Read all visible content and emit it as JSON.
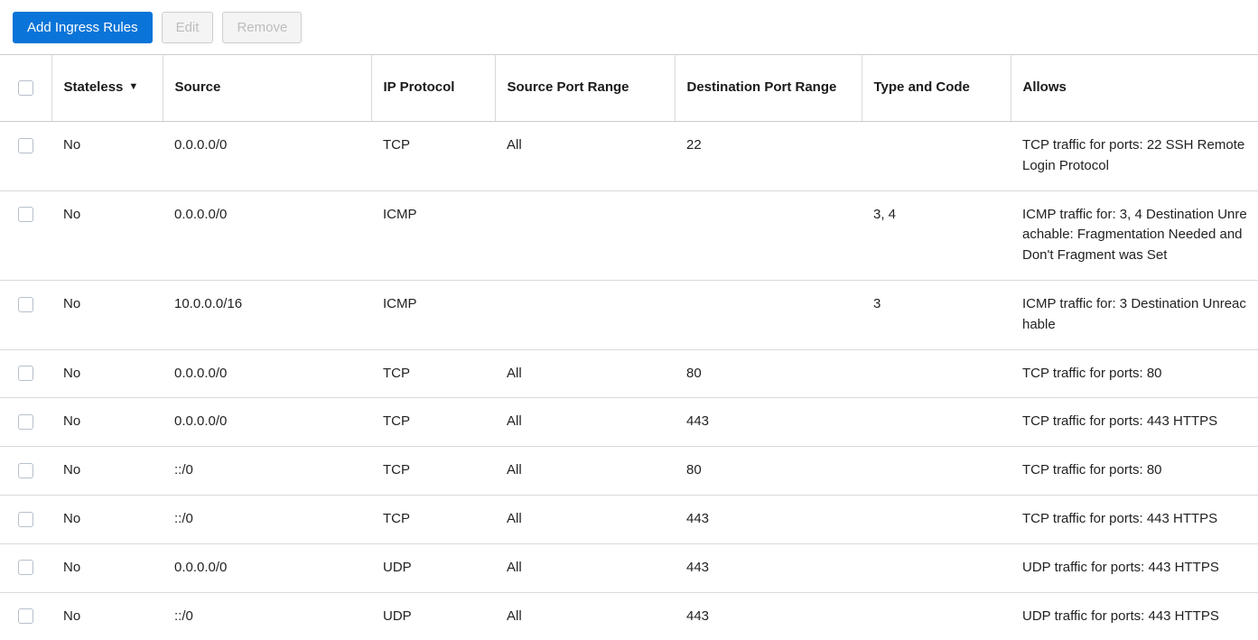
{
  "toolbar": {
    "add_label": "Add Ingress Rules",
    "edit_label": "Edit",
    "remove_label": "Remove",
    "primary_color": "#0a74d8",
    "disabled_text_color": "#bdbdbd"
  },
  "table": {
    "select_all_checked": false,
    "sort_column": "Stateless",
    "sort_caret": "▼",
    "columns": [
      {
        "key": "checkbox",
        "label": ""
      },
      {
        "key": "stateless",
        "label": "Stateless",
        "sortable": true
      },
      {
        "key": "source",
        "label": "Source"
      },
      {
        "key": "protocol",
        "label": "IP Protocol"
      },
      {
        "key": "source_port_range",
        "label": "Source Port Range"
      },
      {
        "key": "destination_port_range",
        "label": "Destination Port Range"
      },
      {
        "key": "type_and_code",
        "label": "Type and Code"
      },
      {
        "key": "allows",
        "label": "Allows"
      }
    ],
    "rows": [
      {
        "selected": false,
        "stateless": "No",
        "source": "0.0.0.0/0",
        "protocol": "TCP",
        "source_port_range": "All",
        "destination_port_range": "22",
        "type_and_code": "",
        "allows": "TCP traffic for ports: 22 SSH Remote Login Protocol"
      },
      {
        "selected": false,
        "stateless": "No",
        "source": "0.0.0.0/0",
        "protocol": "ICMP",
        "source_port_range": "",
        "destination_port_range": "",
        "type_and_code": "3, 4",
        "allows": "ICMP traffic for: 3, 4 Destination Unreachable: Fragmentation Needed and Don't Fragment was Set"
      },
      {
        "selected": false,
        "stateless": "No",
        "source": "10.0.0.0/16",
        "protocol": "ICMP",
        "source_port_range": "",
        "destination_port_range": "",
        "type_and_code": "3",
        "allows": "ICMP traffic for: 3 Destination Unreachable"
      },
      {
        "selected": false,
        "stateless": "No",
        "source": "0.0.0.0/0",
        "protocol": "TCP",
        "source_port_range": "All",
        "destination_port_range": "80",
        "type_and_code": "",
        "allows": "TCP traffic for ports: 80"
      },
      {
        "selected": false,
        "stateless": "No",
        "source": "0.0.0.0/0",
        "protocol": "TCP",
        "source_port_range": "All",
        "destination_port_range": "443",
        "type_and_code": "",
        "allows": "TCP traffic for ports: 443 HTTPS"
      },
      {
        "selected": false,
        "stateless": "No",
        "source": "::/0",
        "protocol": "TCP",
        "source_port_range": "All",
        "destination_port_range": "80",
        "type_and_code": "",
        "allows": "TCP traffic for ports: 80"
      },
      {
        "selected": false,
        "stateless": "No",
        "source": "::/0",
        "protocol": "TCP",
        "source_port_range": "All",
        "destination_port_range": "443",
        "type_and_code": "",
        "allows": "TCP traffic for ports: 443 HTTPS"
      },
      {
        "selected": false,
        "stateless": "No",
        "source": "0.0.0.0/0",
        "protocol": "UDP",
        "source_port_range": "All",
        "destination_port_range": "443",
        "type_and_code": "",
        "allows": "UDP traffic for ports: 443 HTTPS"
      },
      {
        "selected": false,
        "stateless": "No",
        "source": "::/0",
        "protocol": "UDP",
        "source_port_range": "All",
        "destination_port_range": "443",
        "type_and_code": "",
        "allows": "UDP traffic for ports: 443 HTTPS"
      }
    ]
  }
}
